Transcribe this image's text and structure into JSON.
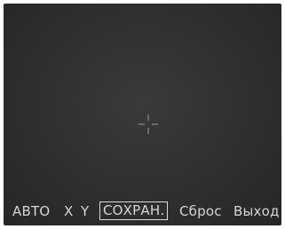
{
  "screen": {
    "crosshair_icon": "crosshair-icon"
  },
  "menu": {
    "items": [
      {
        "label": "АВТО",
        "selected": false
      },
      {
        "label": "X",
        "selected": false
      },
      {
        "label": "Y",
        "selected": false
      },
      {
        "label": "СОХРАН.",
        "selected": true
      },
      {
        "label": "Сброс",
        "selected": false
      },
      {
        "label": "Выход",
        "selected": false
      }
    ]
  },
  "colors": {
    "background": "#2f2f2f",
    "text": "#d6d6d6",
    "crosshair": "#9a9a9a"
  }
}
